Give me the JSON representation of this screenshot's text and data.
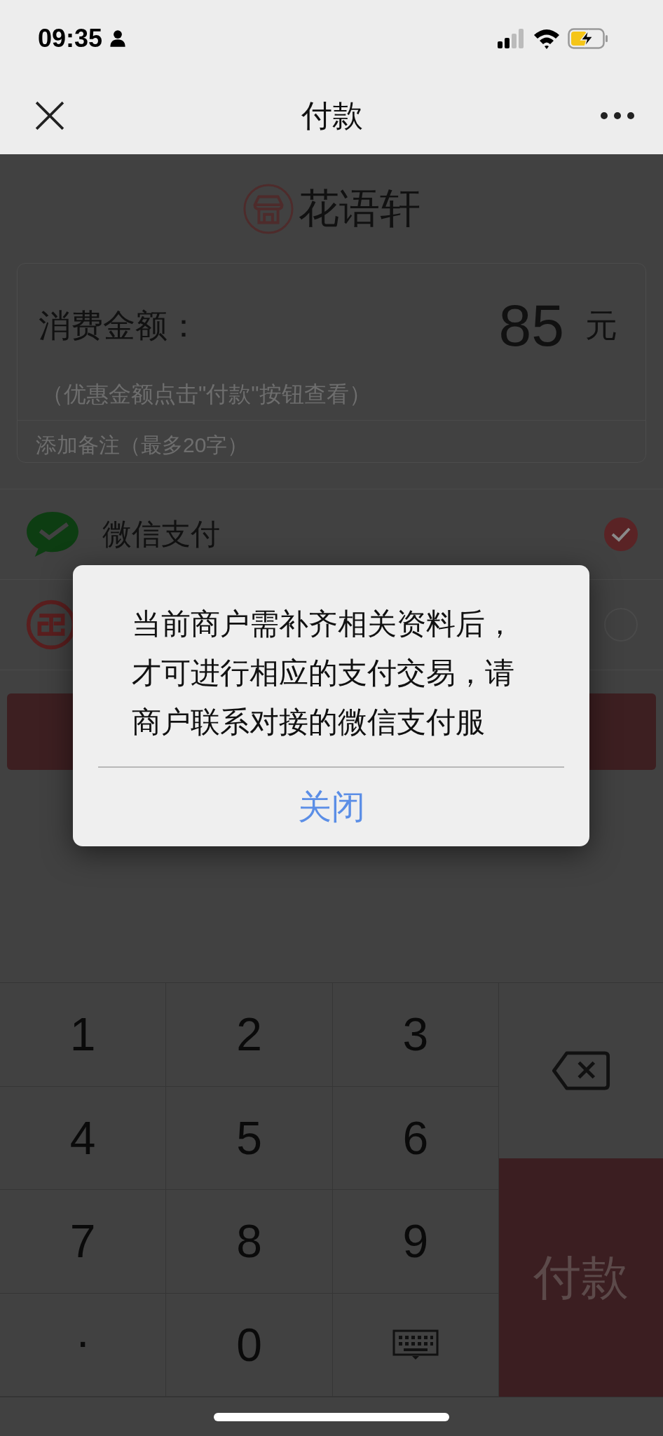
{
  "status_bar": {
    "time": "09:35"
  },
  "nav": {
    "title": "付款"
  },
  "merchant": {
    "name": "花语轩"
  },
  "amount_card": {
    "label": "消费金额：",
    "amount": "85",
    "unit": "元",
    "hint": "（优惠金额点击\"付款\"按钮查看）",
    "note_placeholder": "添加备注（最多20字）"
  },
  "payment_methods": [
    {
      "kind": "wechat",
      "label": "微信支付",
      "selected": true
    },
    {
      "kind": "bank",
      "selected": false
    }
  ],
  "dialog": {
    "message": "当前商户需补齐相关资料后，才可进行相应的支付交易，请商户联系对接的微信支付服",
    "button": "关闭"
  },
  "keypad": {
    "keys": [
      "1",
      "2",
      "3",
      "4",
      "5",
      "6",
      "7",
      "8",
      "9",
      ".",
      "0"
    ],
    "pay_button": "付款"
  }
}
